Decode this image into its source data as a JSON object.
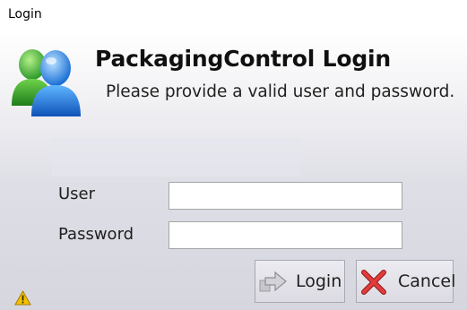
{
  "window": {
    "title": "Login"
  },
  "header": {
    "title": "PackagingControl Login",
    "subtitle": "Please provide a valid user and password.",
    "icon": "users-icon"
  },
  "form": {
    "user_label": "User",
    "user_value": "",
    "password_label": "Password",
    "password_value": ""
  },
  "buttons": {
    "login_label": "Login",
    "login_icon": "login-arrow-icon",
    "cancel_label": "Cancel",
    "cancel_icon": "red-x-icon"
  },
  "status": {
    "icon": "warning-icon",
    "icon_color": "#f2c200"
  }
}
